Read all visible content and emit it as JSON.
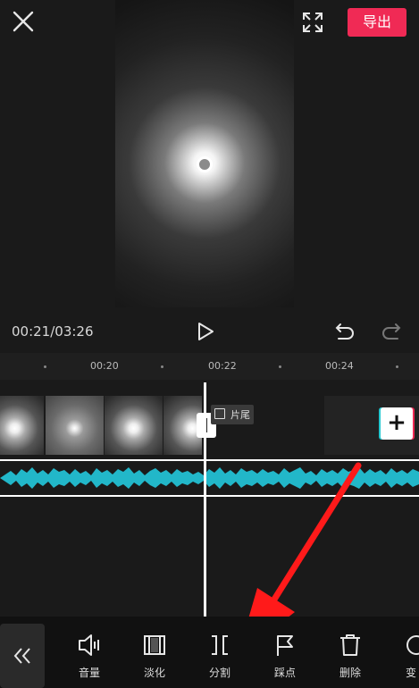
{
  "header": {
    "close_icon": "close-icon",
    "fullscreen_icon": "fullscreen-icon",
    "export_label": "导出",
    "export_color": "#f02a55"
  },
  "player": {
    "time": "00:21/03:26"
  },
  "ruler": {
    "labels": [
      "00:20",
      "00:22",
      "00:24"
    ]
  },
  "timeline": {
    "end_clip_label": "片尾",
    "add_label": "+",
    "audio_color": "#22b7c9"
  },
  "toolbar": {
    "tools": [
      "音量",
      "淡化",
      "分割",
      "踩点",
      "删除",
      "变"
    ]
  },
  "annotation": {
    "arrow_color": "#ff1a1a"
  }
}
